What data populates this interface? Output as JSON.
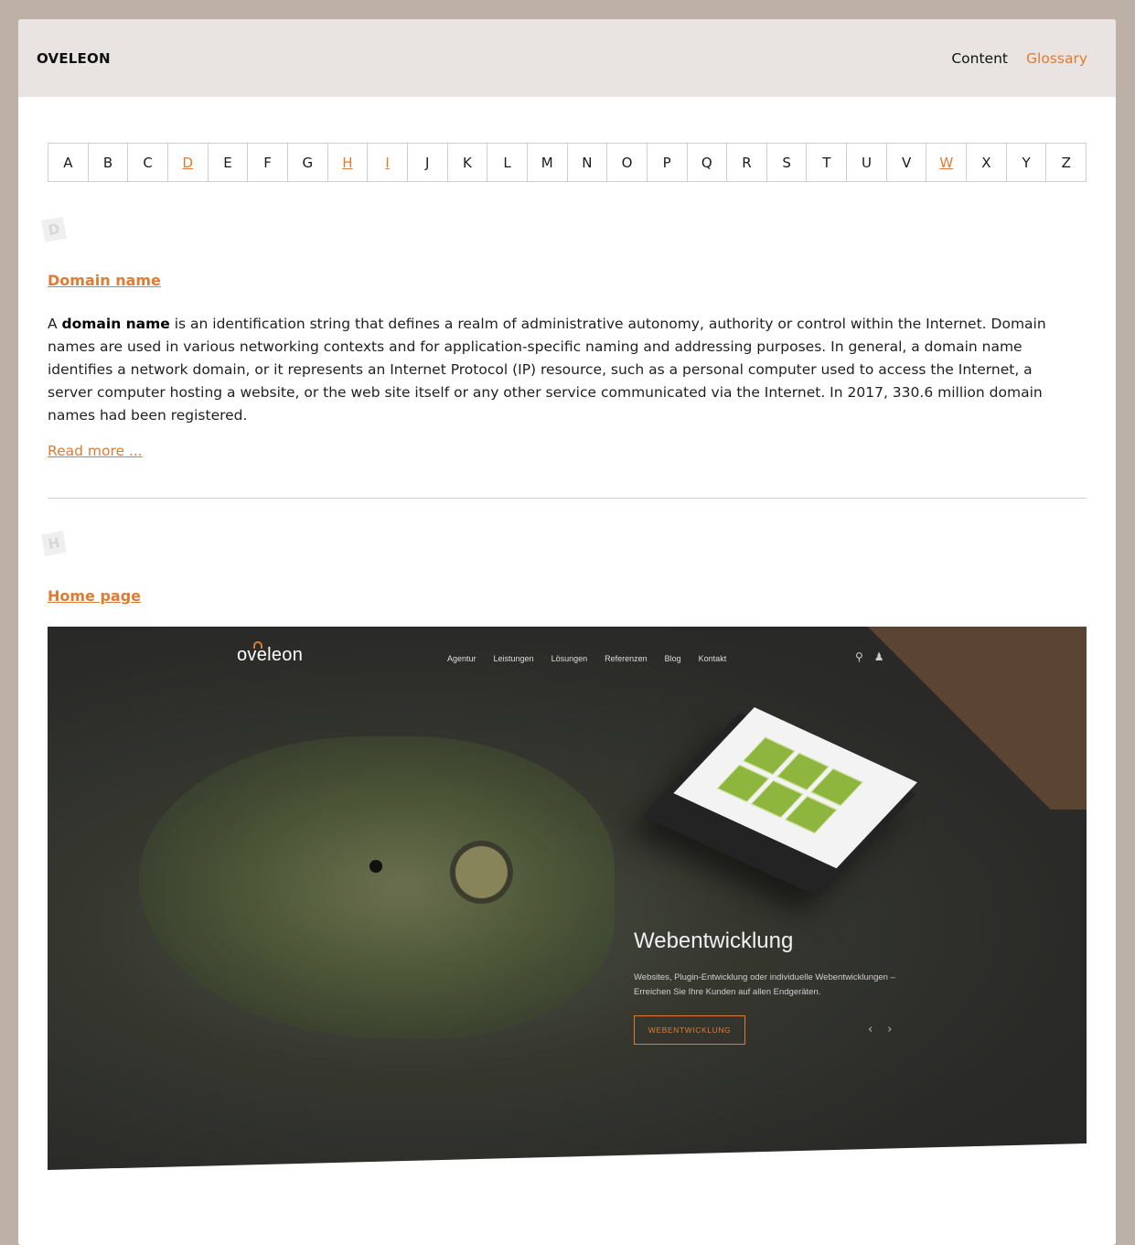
{
  "header": {
    "brand": "OVELEON",
    "nav": [
      {
        "label": "Content",
        "active": false
      },
      {
        "label": "Glossary",
        "active": true
      }
    ]
  },
  "alphabet": [
    {
      "letter": "A",
      "has_entries": false
    },
    {
      "letter": "B",
      "has_entries": false
    },
    {
      "letter": "C",
      "has_entries": false
    },
    {
      "letter": "D",
      "has_entries": true
    },
    {
      "letter": "E",
      "has_entries": false
    },
    {
      "letter": "F",
      "has_entries": false
    },
    {
      "letter": "G",
      "has_entries": false
    },
    {
      "letter": "H",
      "has_entries": true
    },
    {
      "letter": "I",
      "has_entries": true
    },
    {
      "letter": "J",
      "has_entries": false
    },
    {
      "letter": "K",
      "has_entries": false
    },
    {
      "letter": "L",
      "has_entries": false
    },
    {
      "letter": "M",
      "has_entries": false
    },
    {
      "letter": "N",
      "has_entries": false
    },
    {
      "letter": "O",
      "has_entries": false
    },
    {
      "letter": "P",
      "has_entries": false
    },
    {
      "letter": "Q",
      "has_entries": false
    },
    {
      "letter": "R",
      "has_entries": false
    },
    {
      "letter": "S",
      "has_entries": false
    },
    {
      "letter": "T",
      "has_entries": false
    },
    {
      "letter": "U",
      "has_entries": false
    },
    {
      "letter": "V",
      "has_entries": false
    },
    {
      "letter": "W",
      "has_entries": true
    },
    {
      "letter": "X",
      "has_entries": false
    },
    {
      "letter": "Y",
      "has_entries": false
    },
    {
      "letter": "Z",
      "has_entries": false
    }
  ],
  "sections": {
    "d": {
      "letter": "D",
      "term": "Domain name",
      "definition_lead": "A ",
      "definition_bold": "domain name",
      "definition_rest": " is an identification string that defines a realm of administrative autonomy, authority or control within the Internet. Domain names are used in various networking contexts and for application-specific naming and addressing purposes. In general, a domain name identifies a network domain, or it represents an Internet Protocol (IP) resource, such as a personal computer used to access the Internet, a server computer hosting a website, or the web site itself or any other service communicated via the Internet. In 2017, 330.6 million domain names had been registered.",
      "read_more": "Read more ..."
    },
    "h": {
      "letter": "H",
      "term": "Home page",
      "screenshot": {
        "logo": "oveleon",
        "nav": [
          "Agentur",
          "Leistungen",
          "Lösungen",
          "Referenzen",
          "Blog",
          "Kontakt"
        ],
        "headline": "Webentwicklung",
        "subline": "Websites, Plugin-Entwicklung oder individuelle Webentwicklungen – Erreichen Sie Ihre Kunden auf allen Endgeräten.",
        "cta": "WEBENTWICKLUNG"
      }
    }
  },
  "colors": {
    "accent": "#e07b33",
    "header_bg": "#e9e4e1",
    "page_bg": "#bcb0a7"
  }
}
